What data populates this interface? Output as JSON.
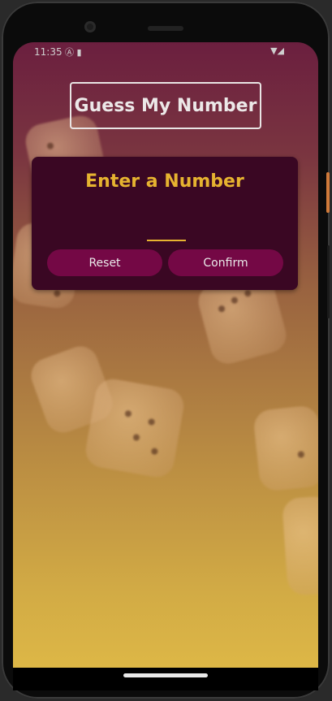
{
  "status_bar": {
    "time": "11:35",
    "left_icons": "Ⓐ ▮",
    "right_icons": "▼◢"
  },
  "app": {
    "title": "Guess My Number",
    "card": {
      "title": "Enter a Number",
      "input_value": "",
      "input_placeholder": ""
    },
    "buttons": {
      "reset_label": "Reset",
      "confirm_label": "Confirm"
    }
  },
  "colors": {
    "accent": "#e6b330",
    "card_bg": "#3a0723",
    "button_bg": "#740845"
  }
}
